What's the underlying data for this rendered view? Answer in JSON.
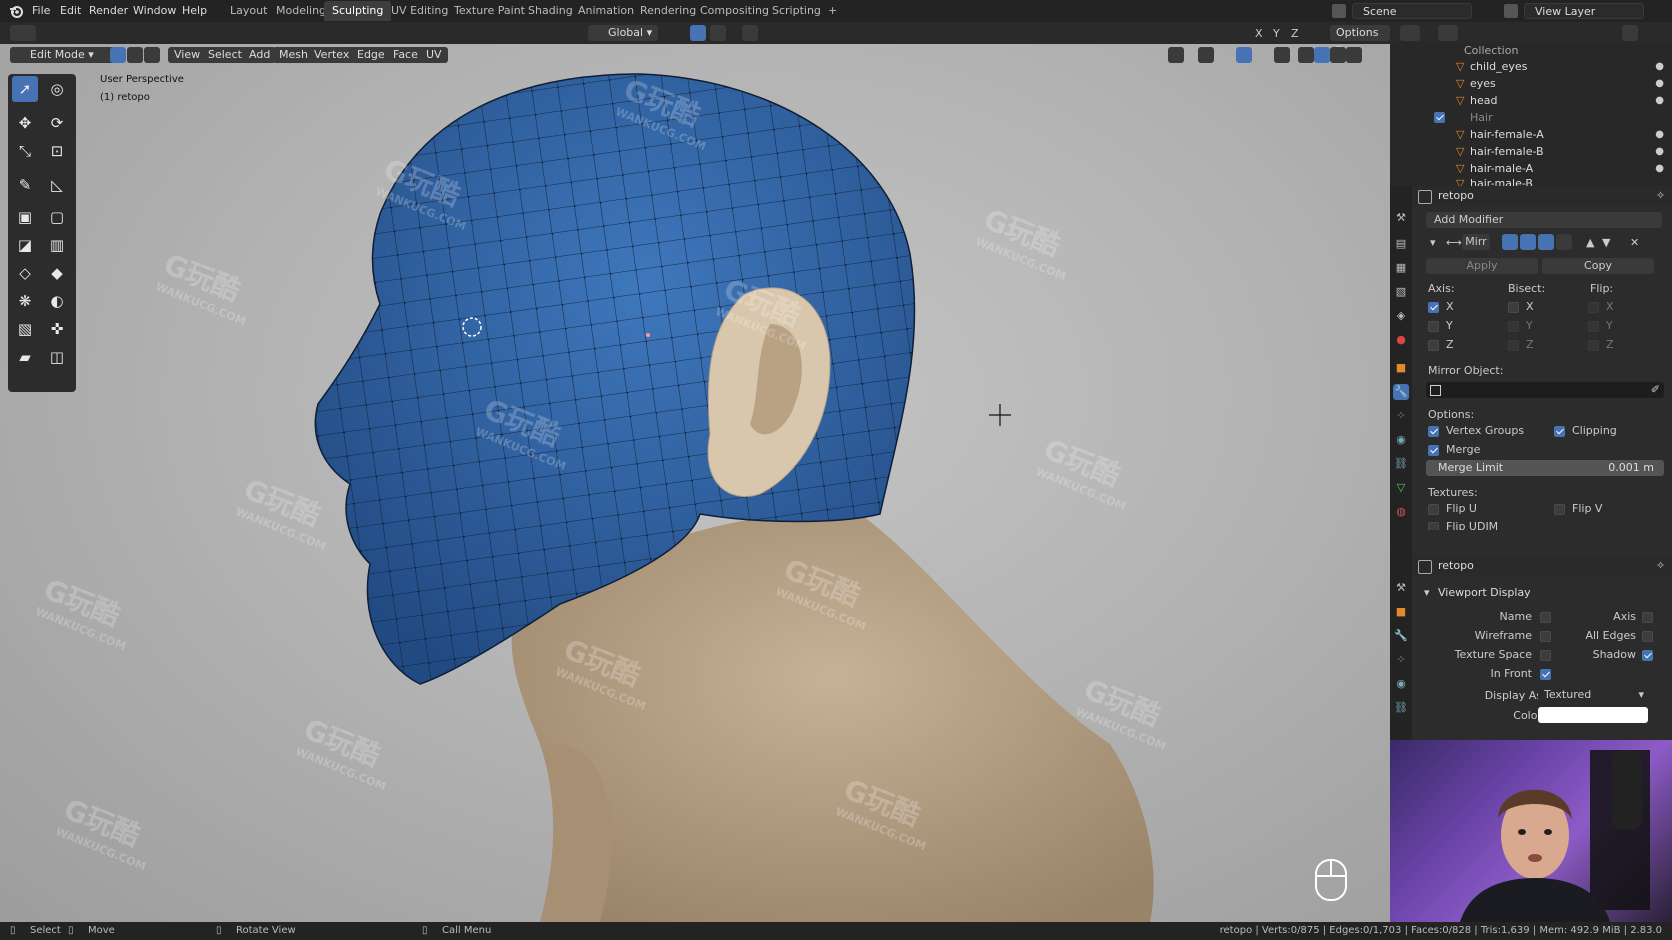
{
  "menu": {
    "items": [
      "File",
      "Edit",
      "Render",
      "Window",
      "Help"
    ]
  },
  "workspaces": {
    "items": [
      "Layout",
      "Modeling",
      "Sculpting",
      "UV Editing",
      "Texture Paint",
      "Shading",
      "Animation",
      "Rendering",
      "Compositing",
      "Scripting"
    ],
    "active": "Sculpting",
    "add": "+"
  },
  "topright": {
    "scene": "Scene",
    "view_layer": "View Layer"
  },
  "header": {
    "mode": "Edit Mode",
    "menus": [
      "View",
      "Select",
      "Add",
      "Mesh",
      "Vertex",
      "Edge",
      "Face",
      "UV"
    ],
    "orientation": "Global",
    "axes": [
      "X",
      "Y",
      "Z"
    ],
    "options": "Options"
  },
  "viewport": {
    "view_name": "User Perspective",
    "object_name": "(1) retopo"
  },
  "outliner": {
    "rows": [
      {
        "name": "Collection",
        "kind": "collection"
      },
      {
        "name": "child_eyes",
        "kind": "mesh"
      },
      {
        "name": "eyes",
        "kind": "mesh"
      },
      {
        "name": "head",
        "kind": "mesh"
      },
      {
        "name": "Hair",
        "kind": "collection"
      },
      {
        "name": "hair-female-A",
        "kind": "mesh"
      },
      {
        "name": "hair-female-B",
        "kind": "mesh"
      },
      {
        "name": "hair-male-A",
        "kind": "mesh"
      },
      {
        "name": "hair-male-B",
        "kind": "mesh"
      }
    ]
  },
  "modifier_panel": {
    "object": "retopo",
    "add_modifier": "Add Modifier",
    "modifier_name": "Mirr",
    "apply": "Apply",
    "copy": "Copy",
    "axis_label": "Axis:",
    "bisect_label": "Bisect:",
    "flip_label": "Flip:",
    "axes": [
      "X",
      "Y",
      "Z"
    ],
    "axis_checked": [
      true,
      false,
      false
    ],
    "mirror_object_label": "Mirror Object:",
    "options_label": "Options:",
    "vertex_groups": "Vertex Groups",
    "clipping": "Clipping",
    "merge": "Merge",
    "merge_limit_label": "Merge Limit",
    "merge_limit_value": "0.001 m",
    "textures_label": "Textures:",
    "flip_u": "Flip U",
    "flip_v": "Flip V",
    "flip_udim": "Flip UDIM"
  },
  "object_panel": {
    "object": "retopo",
    "section": "Viewport Display",
    "name": "Name",
    "axis": "Axis",
    "wireframe": "Wireframe",
    "all_edges": "All Edges",
    "texture_space": "Texture Space",
    "shadow": "Shadow",
    "in_front": "In Front",
    "display_as_label": "Display As",
    "display_as_value": "Textured",
    "color_label": "Color"
  },
  "status": {
    "select": "Select",
    "move": "Move",
    "rotate_view": "Rotate View",
    "call_menu": "Call Menu",
    "stats": "retopo | Verts:0/875 | Edges:0/1,703 | Faces:0/828 | Tris:1,639 | Mem: 492.9 MiB | 2.83.0"
  },
  "watermark": {
    "text": "G玩酷",
    "sub": "WANKUCG.COM"
  },
  "colors": {
    "accent": "#4772b3",
    "mesh": "#3a6fb0",
    "skin": "#b9a488",
    "orange": "#e08a2c"
  }
}
